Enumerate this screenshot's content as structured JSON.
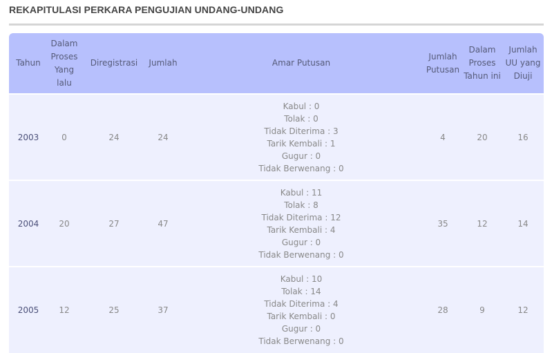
{
  "page": {
    "title": "REKAPITULASI PERKARA PENGUJIAN UNDANG-UNDANG"
  },
  "table": {
    "headers": {
      "tahun": "Tahun",
      "dalam_proses_lalu": "Dalam Proses Yang lalu",
      "diregistrasi": "Diregistrasi",
      "jumlah": "Jumlah",
      "amar_putusan": "Amar Putusan",
      "jumlah_putusan": "Jumlah Putusan",
      "dalam_proses_ini": "Dalam Proses Tahun ini",
      "jumlah_uu": "Jumlah UU yang Diuji"
    },
    "rows": [
      {
        "tahun": "2003",
        "dalam_proses_lalu": "0",
        "diregistrasi": "24",
        "jumlah": "24",
        "amar": [
          "Kabul : 0",
          "Tolak : 0",
          "Tidak Diterima : 3",
          "Tarik Kembali : 1",
          "Gugur : 0",
          "Tidak Berwenang : 0"
        ],
        "jumlah_putusan": "4",
        "dalam_proses_ini": "20",
        "jumlah_uu": "16"
      },
      {
        "tahun": "2004",
        "dalam_proses_lalu": "20",
        "diregistrasi": "27",
        "jumlah": "47",
        "amar": [
          "Kabul : 11",
          "Tolak : 8",
          "Tidak Diterima : 12",
          "Tarik Kembali : 4",
          "Gugur : 0",
          "Tidak Berwenang : 0"
        ],
        "jumlah_putusan": "35",
        "dalam_proses_ini": "12",
        "jumlah_uu": "14"
      },
      {
        "tahun": "2005",
        "dalam_proses_lalu": "12",
        "diregistrasi": "25",
        "jumlah": "37",
        "amar": [
          "Kabul : 10",
          "Tolak : 14",
          "Tidak Diterima : 4",
          "Tarik Kembali : 0",
          "Gugur : 0",
          "Tidak Berwenang : 0"
        ],
        "jumlah_putusan": "28",
        "dalam_proses_ini": "9",
        "jumlah_uu": "12"
      }
    ]
  },
  "colors": {
    "header_bg": "#b7c0fd",
    "row_bg": "#eef0fe",
    "title_rule": "#d5d5d5"
  }
}
